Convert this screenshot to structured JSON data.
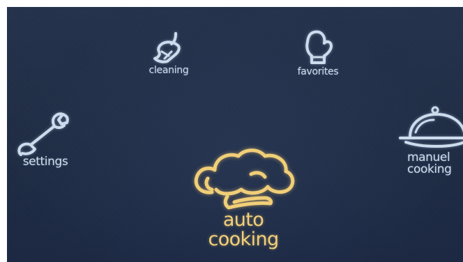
{
  "menu": {
    "cleaning": {
      "label": "cleaning",
      "icon": "broom-icon"
    },
    "favorites": {
      "label": "favorites",
      "icon": "oven-mitt-icon"
    },
    "settings": {
      "label": "settings",
      "icon": "wrench-icon"
    },
    "manual_cooking": {
      "label_line1": "manuel",
      "label_line2": "cooking",
      "icon": "cloche-icon"
    },
    "auto_cooking": {
      "label_line1": "auto",
      "label_line2": "cooking",
      "icon": "chef-hat-icon"
    }
  },
  "colors": {
    "background": "#1f2c45",
    "icon": "#cddcec",
    "highlight": "#f0ce78"
  }
}
